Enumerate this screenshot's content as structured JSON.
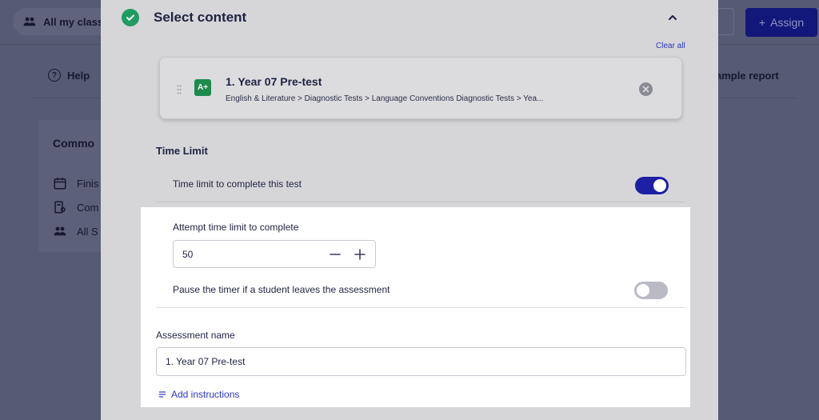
{
  "background": {
    "class_selector": "All my classes",
    "assign_label": "Assign",
    "help_label": "Help",
    "sample_report_label": "ample report",
    "card_title": "Commo",
    "card_items": [
      "Finis",
      "Com",
      "All S"
    ]
  },
  "modal": {
    "title": "Select content",
    "clear_all": "Clear all",
    "content_item": {
      "icon_label": "A+",
      "title": "1. Year 07 Pre-test",
      "path": "English & Literature > Diagnostic Tests > Language Conventions Diagnostic Tests > Yea..."
    },
    "time_limit": {
      "section_title": "Time Limit",
      "toggle_label": "Time limit to complete this test",
      "toggle_on": true,
      "attempt_label": "Attempt time limit to complete",
      "attempt_value": "50",
      "pause_label": "Pause the timer if a student leaves the assessment",
      "pause_on": false
    },
    "assessment_name": {
      "label": "Assessment name",
      "value": "1. Year 07 Pre-test"
    },
    "add_instructions": "Add instructions"
  },
  "colors": {
    "accent": "#1d1fa4",
    "link": "#2d37c4",
    "success": "#1f9b63",
    "overlay": "#565b74"
  }
}
